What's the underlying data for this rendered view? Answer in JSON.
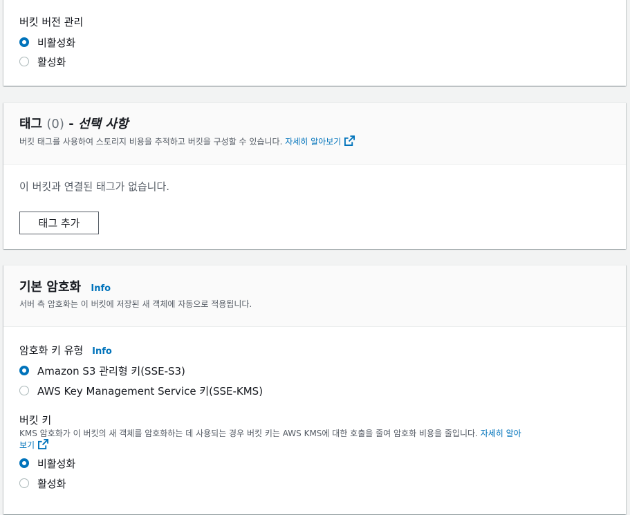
{
  "versioning": {
    "label": "버킷 버전 관리",
    "options": [
      {
        "label": "비활성화",
        "selected": true
      },
      {
        "label": "활성화",
        "selected": false
      }
    ]
  },
  "tags": {
    "title": "태그",
    "count": "(0)",
    "separator": "-",
    "optional": "선택 사항",
    "description": "버킷 태그를 사용하여 스토리지 비용을 추적하고 버킷을 구성할 수 있습니다.",
    "learn_more": "자세히 알아보기",
    "empty_text": "이 버킷과 연결된 태그가 없습니다.",
    "add_button": "태그 추가"
  },
  "encryption": {
    "title": "기본 암호화",
    "info": "Info",
    "description": "서버 측 암호화는 이 버킷에 저장된 새 객체에 자동으로 적용됩니다.",
    "key_type": {
      "label": "암호화 키 유형",
      "info": "Info",
      "options": [
        {
          "label": "Amazon S3 관리형 키(SSE-S3)",
          "selected": true
        },
        {
          "label": "AWS Key Management Service 키(SSE-KMS)",
          "selected": false
        }
      ]
    },
    "bucket_key": {
      "label": "버킷 키",
      "description": "KMS 암호화가 이 버킷의 새 객체를 암호화하는 데 사용되는 경우 버킷 키는 AWS KMS에 대한 호출을 줄여 암호화 비용을 줄입니다.",
      "learn_more_part1": "자세히 알아",
      "learn_more_part2": "보기",
      "options": [
        {
          "label": "비활성화",
          "selected": true
        },
        {
          "label": "활성화",
          "selected": false
        }
      ]
    }
  },
  "colors": {
    "accent": "#0073bb",
    "text": "#16191f",
    "muted": "#545b64",
    "background": "#f2f3f3"
  }
}
